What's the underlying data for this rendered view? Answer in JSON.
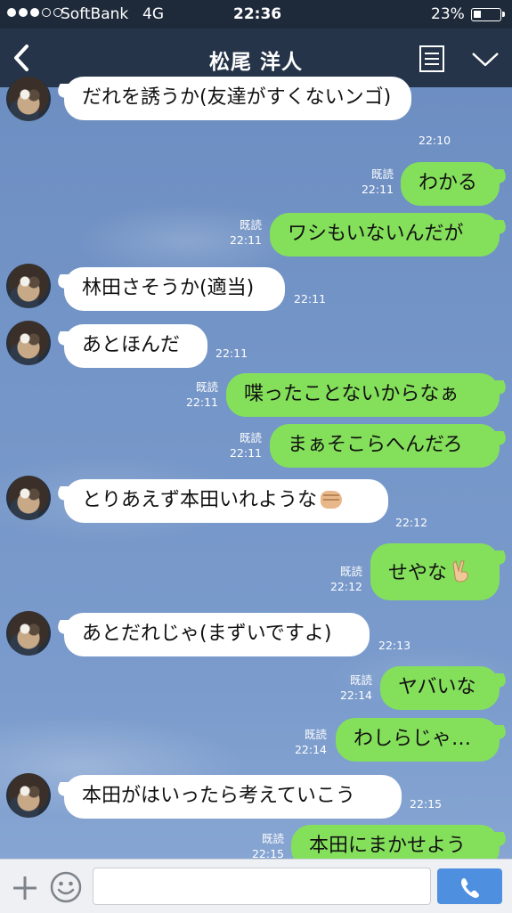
{
  "status_bar": {
    "carrier": "SoftBank",
    "network": "4G",
    "time": "22:36",
    "battery": "23%",
    "signal_bars": 3
  },
  "header": {
    "title": "松尾 洋人",
    "back_icon": "chevron-left-icon",
    "notes_icon": "notes-icon",
    "menu_icon": "chevron-down-icon"
  },
  "messages": [
    {
      "side": "in",
      "text": "だれを誘うか(友達がすくないンゴ)",
      "time": "22:10"
    },
    {
      "side": "out",
      "text": "わかる",
      "read": "既読",
      "time": "22:11"
    },
    {
      "side": "out",
      "text": "ワシもいないんだが",
      "read": "既読",
      "time": "22:11"
    },
    {
      "side": "in",
      "text": "林田さそうか(適当)",
      "time": "22:11"
    },
    {
      "side": "in",
      "text": "あとほんだ",
      "time": "22:11"
    },
    {
      "side": "out",
      "text": "喋ったことないからなぁ",
      "read": "既読",
      "time": "22:11"
    },
    {
      "side": "out",
      "text": "まぁそこらへんだろ",
      "read": "既読",
      "time": "22:11"
    },
    {
      "side": "in",
      "text": "とりあえず本田いれような",
      "emoji": "fist-emoji",
      "time": "22:12"
    },
    {
      "side": "out",
      "text": "せやな",
      "emoji": "peace-emoji",
      "read": "既読",
      "time": "22:12"
    },
    {
      "side": "in",
      "text": "あとだれじゃ(まずいですよ)",
      "time": "22:13"
    },
    {
      "side": "out",
      "text": "ヤバいな",
      "read": "既読",
      "time": "22:14"
    },
    {
      "side": "out",
      "text": "わしらじゃ…",
      "read": "既読",
      "time": "22:14"
    },
    {
      "side": "in",
      "text": "本田がはいったら考えていこう",
      "time": "22:15"
    },
    {
      "side": "out",
      "text": "本田にまかせよう",
      "read": "既読",
      "time": "22:15"
    }
  ],
  "input_bar": {
    "plus_icon": "plus-icon",
    "sticker_icon": "smiley-icon",
    "placeholder": "",
    "send_icon": "phone-icon"
  },
  "colors": {
    "header_bg": "#26344a",
    "outgoing_bubble": "#84e05b",
    "incoming_bubble": "#ffffff",
    "send_button": "#4f8fe0"
  }
}
